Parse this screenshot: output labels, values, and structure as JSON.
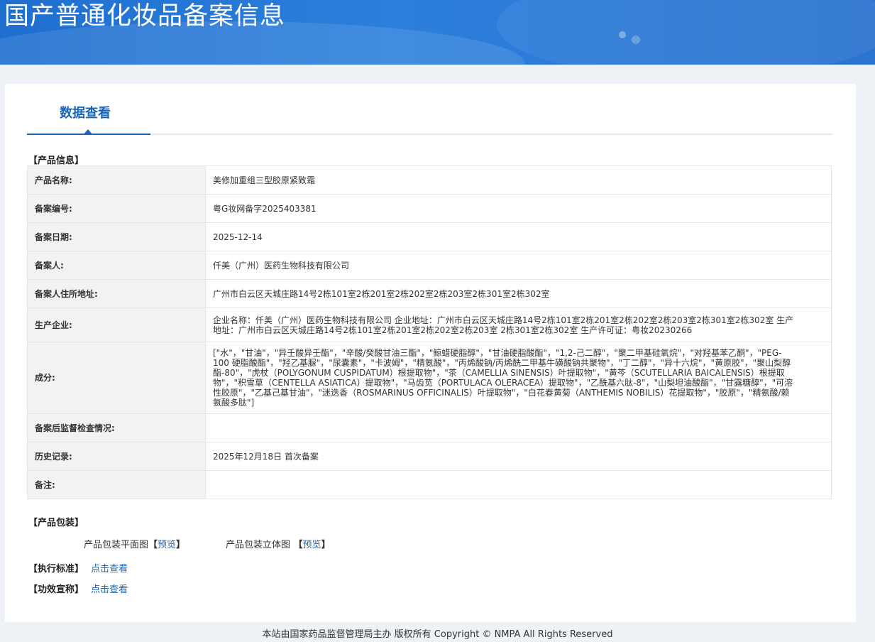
{
  "header": {
    "title": "国产普通化妆品备案信息"
  },
  "tabs": [
    {
      "label": "数据查看"
    }
  ],
  "product_info": {
    "section_label": "【产品信息】",
    "rows": [
      {
        "key": "产品名称:",
        "value": "美修加重组三型胶原紧致霜"
      },
      {
        "key": "备案编号:",
        "value": "粤G妆网备字2025403381"
      },
      {
        "key": "备案日期:",
        "value": "2025-12-14"
      },
      {
        "key": "备案人:",
        "value": "仟美（广州）医药生物科技有限公司"
      },
      {
        "key": "备案人住所地址:",
        "value": "广州市白云区天城庄路14号2栋101室2栋201室2栋202室2栋203室2栋301室2栋302室"
      },
      {
        "key": "生产企业:",
        "value": "企业名称：仟美（广州）医药生物科技有限公司 企业地址：广州市白云区天城庄路14号2栋101室2栋201室2栋202室2栋203室2栋301室2栋302室 生产地址：广州市白云区天城庄路14号2栋101室2栋201室2栋202室2栋203室 2栋301室2栋302室 生产许可证：粤妆20230266"
      },
      {
        "key": "成分:",
        "value": "[\"水\"，\"甘油\"，\"异壬酸异壬酯\"，\"辛酸/癸酸甘油三酯\"，\"鲸蜡硬脂醇\"，\"甘油硬脂酸酯\"，\"1,2-己二醇\"，\"聚二甲基硅氧烷\"，\"对羟基苯乙酮\"，\"PEG-100 硬脂酸酯\"，\"羟乙基脲\"，\"尿囊素\"，\"卡波姆\"，\"精氨酸\"，\"丙烯酸钠/丙烯酰二甲基牛磺酸钠共聚物\"，\"丁二醇\"，\"异十六烷\"，\"黄原胶\"，\"聚山梨醇酯-80\"，\"虎杖（POLYGONUM CUSPIDATUM）根提取物\"，\"茶（CAMELLIA SINENSIS）叶提取物\"，\"黄芩（SCUTELLARIA BAICALENSIS）根提取物\"，\"积雪草（CENTELLA ASIATICA）提取物\"，\"马齿苋（PORTULACA OLERACEA）提取物\"，\"乙酰基六肽-8\"，\"山梨坦油酸酯\"，\"甘露糖醇\"，\"可溶性胶原\"，\"乙基己基甘油\"，\"迷迭香（ROSMARINUS OFFICINALIS）叶提取物\"，\"白花春黄菊（ANTHEMIS NOBILIS）花提取物\"，\"胶原\"，\"精氨酸/赖氨酸多肽\"]"
      },
      {
        "key": "备案后监督检查情况:",
        "value": ""
      },
      {
        "key": "历史记录:",
        "value": "2025年12月18日 首次备案"
      },
      {
        "key": "备注:",
        "value": ""
      }
    ]
  },
  "packaging": {
    "section_label": "【产品包装】",
    "flat_label": "产品包装平面图",
    "flat_bracket_open": "【",
    "flat_link": "预览",
    "flat_bracket_close": "】",
    "solid_label": "产品包装立体图",
    "solid_bracket_open": " 【",
    "solid_link": "预览",
    "solid_bracket_close": "】"
  },
  "standard": {
    "label": "【执行标准】",
    "link": "点击查看"
  },
  "efficacy": {
    "label": "【功效宣称】",
    "link": "点击查看"
  },
  "footer": {
    "text": "本站由国家药品监督管理局主办 版权所有 Copyright © NMPA All Rights Reserved"
  }
}
